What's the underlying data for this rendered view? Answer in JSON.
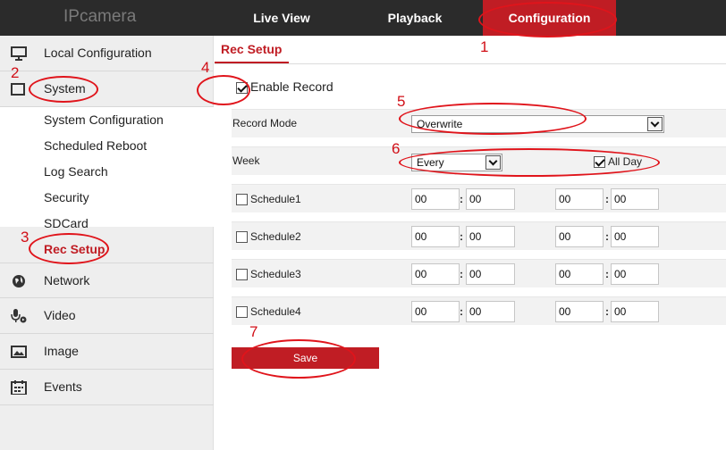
{
  "header": {
    "logo": "IPcamera",
    "nav": [
      {
        "label": "Live View"
      },
      {
        "label": "Playback"
      },
      {
        "label": "Configuration"
      }
    ]
  },
  "sidebar": {
    "main_items": [
      {
        "label": "Local Configuration",
        "icon": "monitor-icon"
      },
      {
        "label": "System",
        "icon": "system-icon"
      },
      {
        "label": "Network",
        "icon": "globe-icon"
      },
      {
        "label": "Video",
        "icon": "microphone-camera-icon"
      },
      {
        "label": "Image",
        "icon": "image-icon"
      },
      {
        "label": "Events",
        "icon": "calendar-icon"
      }
    ],
    "sub_items": [
      {
        "label": "System Configuration"
      },
      {
        "label": "Scheduled Reboot"
      },
      {
        "label": "Log Search"
      },
      {
        "label": "Security"
      },
      {
        "label": "SDCard"
      },
      {
        "label": "Rec Setup",
        "active": true
      }
    ]
  },
  "main": {
    "tab": "Rec Setup",
    "enable_record": {
      "label": "Enable Record",
      "checked": true
    },
    "record_mode": {
      "label": "Record Mode",
      "value": "Overwrite"
    },
    "week": {
      "label": "Week",
      "value": "Every",
      "all_day_label": "All Day",
      "all_day_checked": true
    },
    "schedules": [
      {
        "label": "Schedule1",
        "start_h": "00",
        "start_m": "00",
        "end_h": "00",
        "end_m": "00",
        "checked": false
      },
      {
        "label": "Schedule2",
        "start_h": "00",
        "start_m": "00",
        "end_h": "00",
        "end_m": "00",
        "checked": false
      },
      {
        "label": "Schedule3",
        "start_h": "00",
        "start_m": "00",
        "end_h": "00",
        "end_m": "00",
        "checked": false
      },
      {
        "label": "Schedule4",
        "start_h": "00",
        "start_m": "00",
        "end_h": "00",
        "end_m": "00",
        "checked": false
      }
    ],
    "colon": ":",
    "save_label": "Save"
  },
  "annotations": {
    "n1": "1",
    "n2": "2",
    "n3": "3",
    "n4": "4",
    "n5": "5",
    "n6": "6",
    "n7": "7",
    "color": "#e0141b"
  },
  "colors": {
    "accent": "#c01d24",
    "topbar": "#2b2b2b",
    "sidebar": "#eeeeee"
  }
}
